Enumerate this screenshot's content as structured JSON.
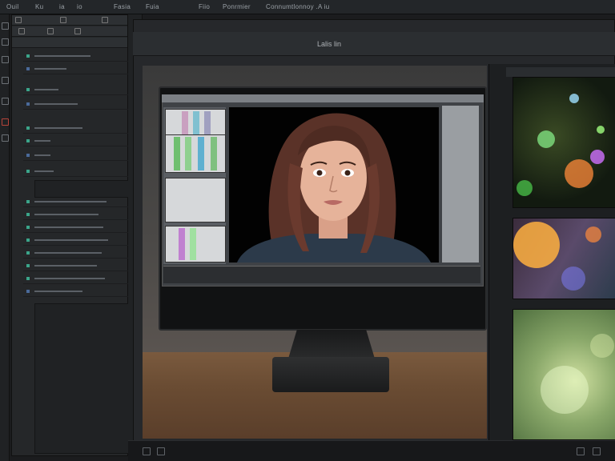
{
  "menubar": {
    "items": [
      "Ouil",
      "Ku",
      "ia",
      "io",
      "Fasia",
      "Fuia",
      "Fiio",
      "Ponrmier",
      "Connumtlonnoy .A iu"
    ]
  },
  "workspace": {
    "title": "Lalis lin"
  },
  "colors": {
    "accent": "#3ba58a",
    "panel": "#252729",
    "background": "#1b1c1e"
  },
  "icons": {
    "panel_menu": "hamburger-icon",
    "close": "close-icon",
    "folder": "folder-icon"
  }
}
